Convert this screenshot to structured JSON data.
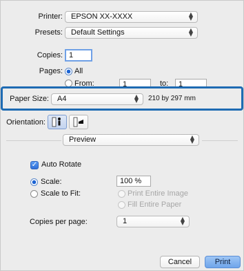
{
  "printer": {
    "label": "Printer:",
    "value": "EPSON XX-XXXX"
  },
  "presets": {
    "label": "Presets:",
    "value": "Default Settings"
  },
  "copies": {
    "label": "Copies:",
    "value": "1"
  },
  "pages": {
    "label": "Pages:",
    "all_label": "All",
    "from_label": "From:",
    "from_value": "1",
    "to_label": "to:",
    "to_value": "1"
  },
  "paper_size": {
    "label": "Paper Size:",
    "value": "A4",
    "dimensions": "210 by 297 mm"
  },
  "orientation": {
    "label": "Orientation:"
  },
  "panel": {
    "value": "Preview"
  },
  "preview": {
    "auto_rotate_label": "Auto Rotate",
    "scale_label": "Scale:",
    "scale_value": "100 %",
    "scale_to_fit_label": "Scale to Fit:",
    "print_entire_image_label": "Print Entire Image",
    "fill_entire_paper_label": "Fill Entire Paper",
    "copies_per_page_label": "Copies per page:",
    "copies_per_page_value": "1"
  },
  "buttons": {
    "cancel": "Cancel",
    "print": "Print"
  },
  "colors": {
    "highlight": "#1e6bb3",
    "accent": "#2f6fd8"
  }
}
